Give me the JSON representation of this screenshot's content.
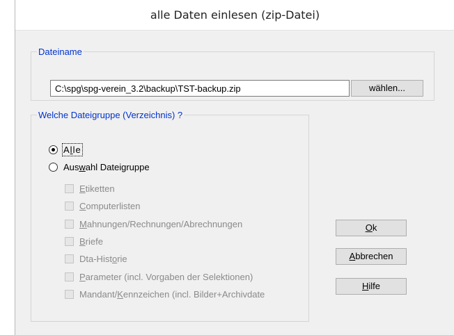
{
  "window": {
    "title": "alle Daten einlesen (zip-Datei)"
  },
  "filename_group": {
    "legend": "Dateiname",
    "path_value": "C:\\spg\\spg-verein_3.2\\backup\\TST-backup.zip",
    "choose_button": "wählen..."
  },
  "filegroup_group": {
    "legend": "Welche Dateigruppe (Verzeichnis) ?",
    "radio_all": {
      "pre": "A",
      "ul": "l",
      "post": "le",
      "selected": true
    },
    "radio_selection": {
      "pre": "Aus",
      "ul": "w",
      "post": "ahl Dateigruppe",
      "selected": false
    },
    "checkboxes": [
      {
        "pre": "",
        "ul": "E",
        "post": "tiketten",
        "checked": false,
        "enabled": false
      },
      {
        "pre": "",
        "ul": "C",
        "post": "omputerlisten",
        "checked": false,
        "enabled": false
      },
      {
        "pre": "",
        "ul": "M",
        "post": "ahnungen/Rechnungen/Abrechnungen",
        "checked": false,
        "enabled": false
      },
      {
        "pre": "",
        "ul": "B",
        "post": "riefe",
        "checked": false,
        "enabled": false
      },
      {
        "pre": "Dta-Hist",
        "ul": "o",
        "post": "rie",
        "checked": false,
        "enabled": false
      },
      {
        "pre": "",
        "ul": "P",
        "post": "arameter (incl. Vorgaben der Selektionen)",
        "checked": false,
        "enabled": false
      },
      {
        "pre": "Mandant/",
        "ul": "K",
        "post": "ennzeichen (incl. Bilder+Archivdate",
        "checked": false,
        "enabled": false
      }
    ]
  },
  "buttons": {
    "ok": {
      "pre": "",
      "ul": "O",
      "post": "k"
    },
    "cancel": {
      "pre": "",
      "ul": "A",
      "post": "bbrechen"
    },
    "help": {
      "pre": "",
      "ul": "H",
      "post": "ilfe"
    }
  }
}
